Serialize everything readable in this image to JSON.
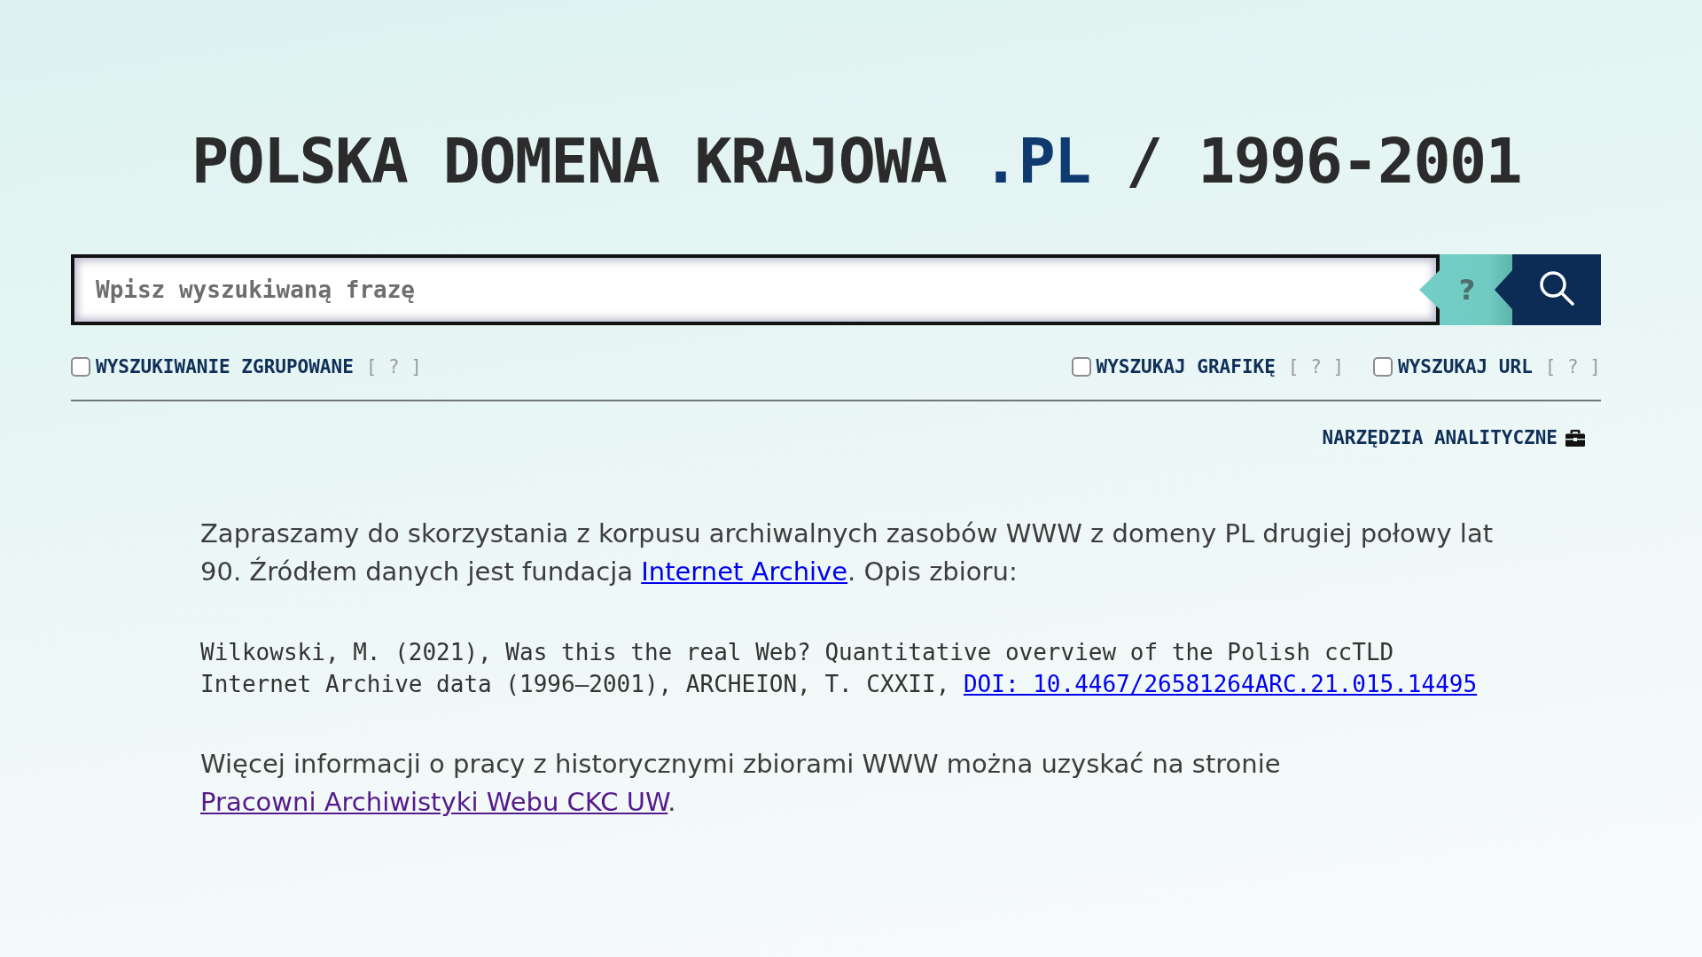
{
  "title": {
    "prefix": "POLSKA DOMENA KRAJOWA",
    "domain": ".PL",
    "suffix": "/ 1996-2001"
  },
  "search": {
    "placeholder": "Wpisz wyszukiwaną frazę",
    "help_button": "?"
  },
  "left_options": [
    {
      "label": "WYSZUKIWANIE ZGRUPOWANE",
      "help": "[ ? ]",
      "checked": false
    }
  ],
  "right_options": [
    {
      "label": "WYSZUKAJ GRAFIKĘ",
      "help": "[ ? ]",
      "checked": false
    },
    {
      "label": "WYSZUKAJ URL",
      "help": "[ ? ]",
      "checked": false
    }
  ],
  "tools_link": "NARZĘDZIA ANALITYCZNE",
  "intro": {
    "text_before": "Zapraszamy do skorzystania z korpusu archiwalnych zasobów WWW z domeny PL drugiej połowy lat 90. Źródłem danych jest fundacja ",
    "link": {
      "text": "Internet Archive",
      "visited": false
    },
    "text_after": ". Opis zbioru:"
  },
  "citation": {
    "text_before": "Wilkowski, M. (2021), Was this the real Web? Quantitative overview of the Polish ccTLD Internet Archive data (1996–2001), ARCHEION, T. CXXII, ",
    "link": {
      "text": "DOI: 10.4467/26581264ARC.21.015.14495",
      "visited": false
    }
  },
  "more_info": {
    "text_before": "Więcej informacji o pracy z historycznymi zbiorami WWW można uzyskać na stronie ",
    "link": {
      "text": "Pracowni Archiwistyki Webu CKC UW",
      "visited": true
    },
    "text_after": "."
  }
}
